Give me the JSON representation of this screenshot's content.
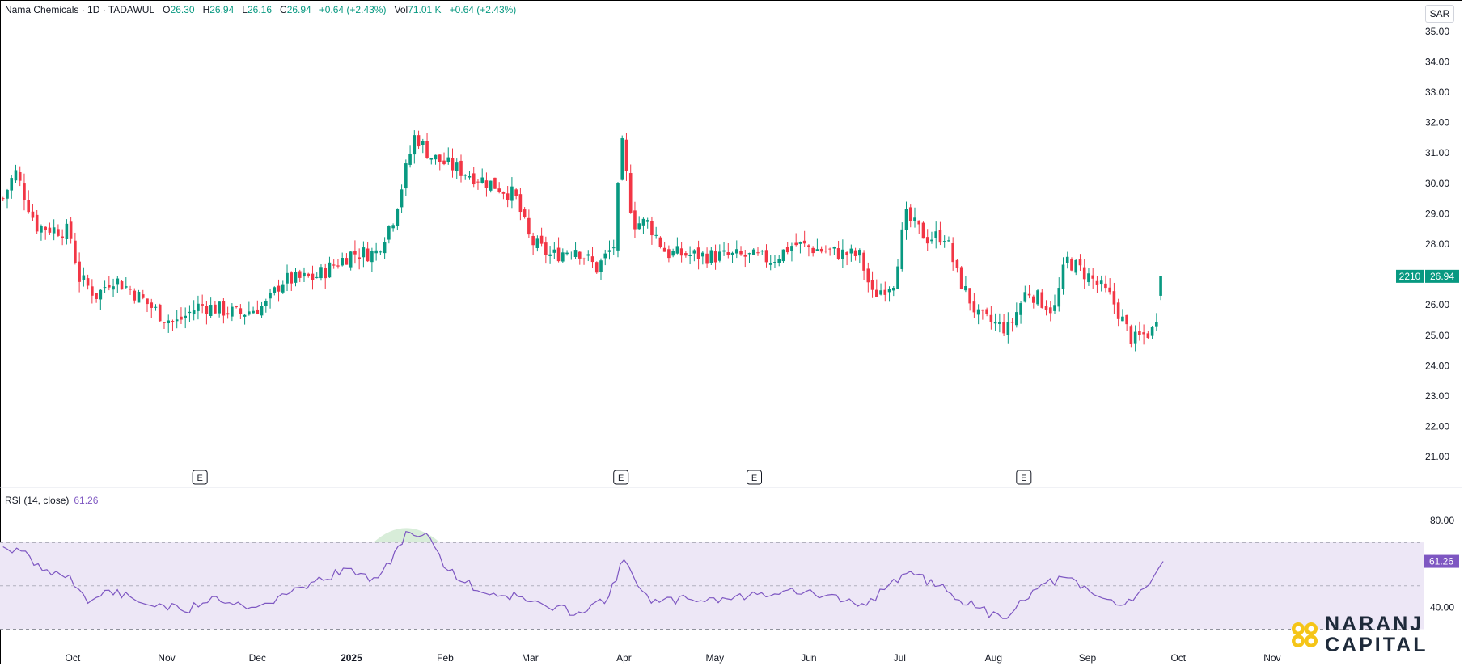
{
  "legend": {
    "symbol": "Nama Chemicals · 1D · TADAWUL",
    "o_label": "O",
    "o_value": "26.30",
    "h_label": "H",
    "h_value": "26.94",
    "l_label": "L",
    "l_value": "26.16",
    "c_label": "C",
    "c_value": "26.94",
    "change": "+0.64 (+2.43%)",
    "vol_label": "Vol",
    "vol_value": "71.01 K",
    "vol_change": "+0.64 (+2.43%)"
  },
  "currency": "SAR",
  "price_badge": {
    "countdown": "2210",
    "price": "26.94"
  },
  "rsi": {
    "title": "RSI (14, close)",
    "value": "61.26",
    "badge": "61.26"
  },
  "earnings_marker": "E",
  "colors": {
    "up": "#089981",
    "down": "#f23645",
    "rsi": "#7e57c2",
    "rsi_band": "#ede7f6"
  },
  "logo": {
    "line1": "NARANJ",
    "line2": "CAPITAL"
  },
  "chart_data": [
    {
      "type": "candlestick",
      "title": "Nama Chemicals · 1D · TADAWUL",
      "ylim": [
        20.5,
        35.5
      ],
      "y_ticks": [
        "35.00",
        "34.00",
        "33.00",
        "32.00",
        "31.00",
        "30.00",
        "29.00",
        "28.00",
        "27.00",
        "26.00",
        "25.00",
        "24.00",
        "23.00",
        "22.00",
        "21.00"
      ],
      "x_ticks": [
        {
          "date": "2024-10-01",
          "label": "Oct"
        },
        {
          "date": "2024-11-01",
          "label": "Nov"
        },
        {
          "date": "2024-12-01",
          "label": "Dec"
        },
        {
          "date": "2025-01-01",
          "label": "2025"
        },
        {
          "date": "2025-02-01",
          "label": "Feb"
        },
        {
          "date": "2025-03-01",
          "label": "Mar"
        },
        {
          "date": "2025-04-01",
          "label": "Apr"
        },
        {
          "date": "2025-05-01",
          "label": "May"
        },
        {
          "date": "2025-06-01",
          "label": "Jun"
        },
        {
          "date": "2025-07-01",
          "label": "Jul"
        },
        {
          "date": "2025-08-01",
          "label": "Aug"
        },
        {
          "date": "2025-09-01",
          "label": "Sep"
        },
        {
          "date": "2025-10-01",
          "label": "Oct"
        },
        {
          "date": "2025-11-01",
          "label": "Nov"
        }
      ],
      "earnings_dates": [
        "2024-11-12",
        "2025-03-31",
        "2025-05-14",
        "2025-08-11"
      ],
      "close_path": [
        [
          "2024-09-08",
          29.5
        ],
        [
          "2024-09-12",
          30.4
        ],
        [
          "2024-09-19",
          28.6
        ],
        [
          "2024-09-30",
          28.4
        ],
        [
          "2024-10-03",
          26.9
        ],
        [
          "2024-10-09",
          26.3
        ],
        [
          "2024-10-14",
          26.9
        ],
        [
          "2024-10-20",
          26.5
        ],
        [
          "2024-10-31",
          25.6
        ],
        [
          "2024-11-04",
          25.4
        ],
        [
          "2024-11-12",
          26.0
        ],
        [
          "2024-11-25",
          25.7
        ],
        [
          "2024-12-04",
          26.0
        ],
        [
          "2024-12-09",
          26.8
        ],
        [
          "2024-12-20",
          26.9
        ],
        [
          "2025-01-01",
          27.7
        ],
        [
          "2025-01-09",
          27.7
        ],
        [
          "2025-01-15",
          28.9
        ],
        [
          "2025-01-22",
          31.6
        ],
        [
          "2025-01-27",
          30.9
        ],
        [
          "2025-02-02",
          30.6
        ],
        [
          "2025-02-16",
          30.0
        ],
        [
          "2025-02-24",
          29.6
        ],
        [
          "2025-03-01",
          28.1
        ],
        [
          "2025-03-08",
          27.6
        ],
        [
          "2025-03-16",
          27.9
        ],
        [
          "2025-03-23",
          27.2
        ],
        [
          "2025-03-29",
          28.0
        ],
        [
          "2025-03-31",
          31.5
        ],
        [
          "2025-04-04",
          28.7
        ],
        [
          "2025-04-09",
          28.7
        ],
        [
          "2025-04-15",
          27.7
        ],
        [
          "2025-04-30",
          27.6
        ],
        [
          "2025-05-10",
          27.6
        ],
        [
          "2025-05-20",
          27.5
        ],
        [
          "2025-05-27",
          28.0
        ],
        [
          "2025-06-05",
          27.8
        ],
        [
          "2025-06-18",
          27.6
        ],
        [
          "2025-06-22",
          26.3
        ],
        [
          "2025-06-29",
          26.8
        ],
        [
          "2025-07-03",
          28.9
        ],
        [
          "2025-07-10",
          28.2
        ],
        [
          "2025-07-16",
          28.3
        ],
        [
          "2025-07-20",
          27.0
        ],
        [
          "2025-07-27",
          25.6
        ],
        [
          "2025-08-06",
          25.2
        ],
        [
          "2025-08-12",
          26.5
        ],
        [
          "2025-08-21",
          25.8
        ],
        [
          "2025-08-25",
          27.5
        ],
        [
          "2025-09-02",
          26.9
        ],
        [
          "2025-09-09",
          26.2
        ],
        [
          "2025-09-16",
          24.8
        ],
        [
          "2025-09-23",
          25.2
        ],
        [
          "2025-09-26",
          26.94
        ]
      ]
    },
    {
      "type": "line",
      "title": "RSI (14, close)",
      "ylim": [
        22,
        92
      ],
      "y_ticks": [
        "80.00",
        "40.00"
      ],
      "bands": [
        70,
        50,
        30
      ],
      "values": [
        [
          "2024-09-08",
          68
        ],
        [
          "2024-09-14",
          66
        ],
        [
          "2024-09-21",
          57
        ],
        [
          "2024-09-30",
          55
        ],
        [
          "2024-10-06",
          42
        ],
        [
          "2024-10-13",
          48
        ],
        [
          "2024-10-24",
          42
        ],
        [
          "2024-10-31",
          41
        ],
        [
          "2024-11-07",
          38
        ],
        [
          "2024-11-16",
          45
        ],
        [
          "2024-11-26",
          41
        ],
        [
          "2024-12-05",
          42
        ],
        [
          "2024-12-12",
          47
        ],
        [
          "2024-12-20",
          52
        ],
        [
          "2025-01-01",
          58
        ],
        [
          "2025-01-07",
          52
        ],
        [
          "2025-01-14",
          60
        ],
        [
          "2025-01-19",
          75
        ],
        [
          "2025-01-27",
          72
        ],
        [
          "2025-02-02",
          57
        ],
        [
          "2025-02-13",
          47
        ],
        [
          "2025-02-25",
          45
        ],
        [
          "2025-03-07",
          40
        ],
        [
          "2025-03-17",
          38
        ],
        [
          "2025-03-27",
          45
        ],
        [
          "2025-04-01",
          62
        ],
        [
          "2025-04-10",
          42
        ],
        [
          "2025-04-22",
          44
        ],
        [
          "2025-05-05",
          44
        ],
        [
          "2025-05-15",
          46
        ],
        [
          "2025-05-25",
          48
        ],
        [
          "2025-06-03",
          46
        ],
        [
          "2025-06-13",
          43
        ],
        [
          "2025-06-20",
          41
        ],
        [
          "2025-06-29",
          53
        ],
        [
          "2025-07-06",
          55
        ],
        [
          "2025-07-14",
          50
        ],
        [
          "2025-07-26",
          40
        ],
        [
          "2025-08-04",
          35
        ],
        [
          "2025-08-14",
          48
        ],
        [
          "2025-08-24",
          54
        ],
        [
          "2025-09-03",
          46
        ],
        [
          "2025-09-12",
          41
        ],
        [
          "2025-09-20",
          49
        ],
        [
          "2025-09-26",
          61.26
        ]
      ]
    }
  ]
}
